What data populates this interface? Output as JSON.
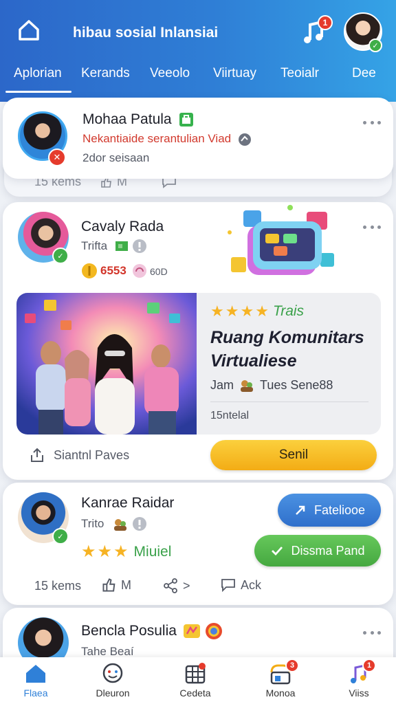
{
  "header": {
    "title": "hibau sosial Inlansiai",
    "music_badge": "1",
    "avatar_badge": "✓"
  },
  "tabs": [
    {
      "label": "Aplorian"
    },
    {
      "label": "Kerands"
    },
    {
      "label": "Veeolo"
    },
    {
      "label": "Viirtuay"
    },
    {
      "label": "Teoialr"
    },
    {
      "label": "Dee"
    }
  ],
  "post1": {
    "name": "Mohaa Patula",
    "line1": "Nekantiaide serantulian Viad",
    "line2": "2dor seisaan",
    "stat_views": "15 kems",
    "stat_m": "M"
  },
  "post2": {
    "name": "Cavaly Rada",
    "sub": "Trifta",
    "score": "6553",
    "score_tag": "60D",
    "promo": {
      "rating_label": "Trais",
      "title": "Ruang Komunitars Virtualiese",
      "meta": "Jam",
      "meta2": "Tues Sene88",
      "footer": "15ntelal"
    },
    "share_label": "Siantnl Paves",
    "action_label": "Senil"
  },
  "post3": {
    "name": "Kanrae Raidar",
    "sub": "Trito",
    "rating_label": "Miuiel",
    "btn_primary": "Fateliooe",
    "btn_secondary": "Dissma Pand",
    "stat_views": "15 kems",
    "stat_m": "M",
    "stat_share": ">",
    "stat_ack": "Ack"
  },
  "post4": {
    "name": "Bencla Posulia",
    "sub": "Tahe Beaí"
  },
  "bottom_nav": [
    {
      "label": "Flaea"
    },
    {
      "label": "Dleuron"
    },
    {
      "label": "Cedeta"
    },
    {
      "label": "Monoa",
      "badge": "3"
    },
    {
      "label": "Viiss",
      "badge": "1"
    }
  ],
  "colors": {
    "header_start": "#2c67c9",
    "header_end": "#35a3e6",
    "accent_yellow": "#f6bd26",
    "accent_blue": "#3b7fd4",
    "accent_green": "#54b94f",
    "badge_red": "#e53b2c"
  }
}
